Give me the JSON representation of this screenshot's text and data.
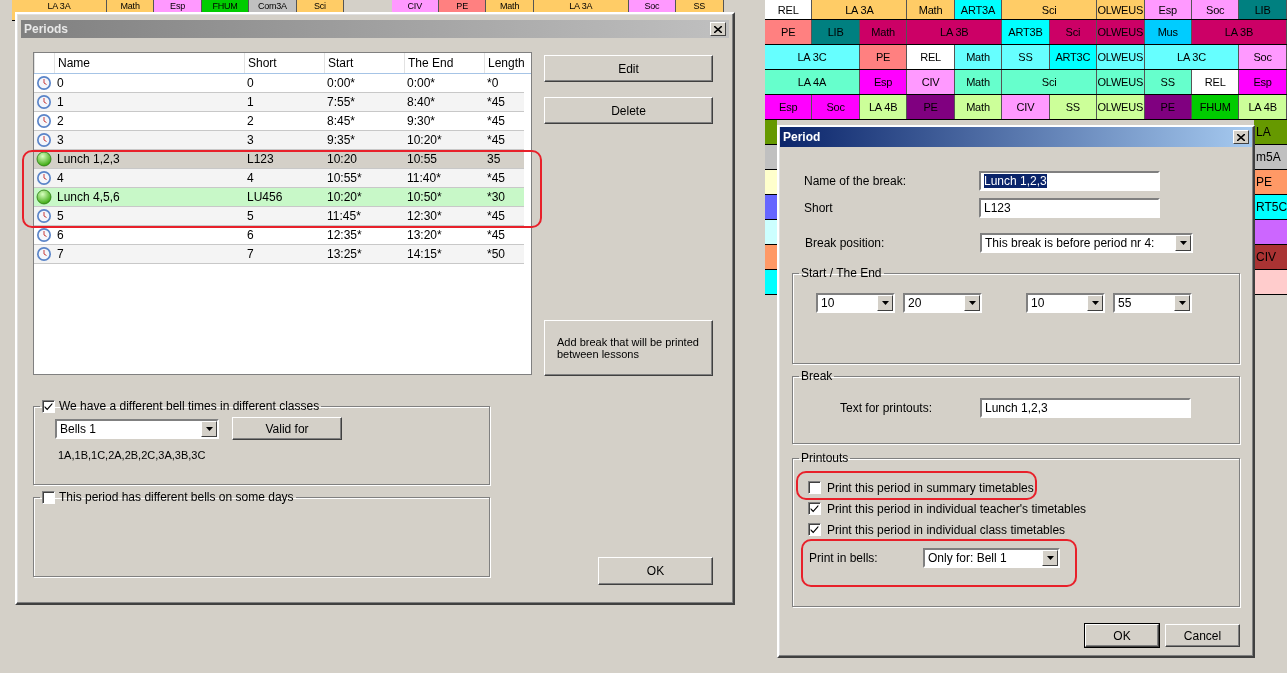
{
  "timetable": {
    "top_row": [
      {
        "kind": "double",
        "text": "LA 3A",
        "color": "#ffcc66"
      },
      {
        "kind": "covered"
      },
      {
        "kind": "single",
        "text": "Math",
        "color": "#ffcc66"
      },
      {
        "kind": "single",
        "text": "Esp",
        "color": "#ff99ff"
      },
      {
        "kind": "single",
        "text": "FHUM",
        "color": "#00cc00"
      },
      {
        "kind": "single",
        "text": "Com3A",
        "color": "#c0c0c0"
      },
      {
        "kind": "single",
        "text": "Sci",
        "color": "#ffcc66"
      },
      {
        "kind": "empty"
      },
      {
        "kind": "single",
        "text": "CIV",
        "color": "#ff99ff"
      },
      {
        "kind": "single",
        "text": "PE",
        "color": "#ff8080"
      },
      {
        "kind": "single",
        "text": "Math",
        "color": "#ffcc66"
      },
      {
        "kind": "double",
        "text": "LA 3A",
        "color": "#ffcc66"
      },
      {
        "kind": "covered"
      },
      {
        "kind": "single",
        "text": "Soc",
        "color": "#ff99ff"
      },
      {
        "kind": "single",
        "text": "SS",
        "color": "#ffcc66"
      }
    ],
    "rows": [
      [
        {
          "kind": "single",
          "text": "REL",
          "color": "#ffffff"
        },
        {
          "kind": "double",
          "text": "LA 3A",
          "color": "#ffcc66"
        },
        {
          "kind": "covered"
        },
        {
          "kind": "single",
          "text": "Math",
          "color": "#ffcc66"
        },
        {
          "kind": "single",
          "text": "ART3A",
          "color": "#00ffff"
        },
        {
          "kind": "double",
          "text": "Sci",
          "color": "#ffcc66"
        },
        {
          "kind": "covered"
        },
        {
          "kind": "single",
          "text": "OLWEUS",
          "color": "#ffcc66"
        },
        {
          "kind": "single",
          "text": "Esp",
          "color": "#ff99ff"
        },
        {
          "kind": "single",
          "text": "Soc",
          "color": "#ff99ff"
        },
        {
          "kind": "single",
          "text": "LIB",
          "color": "#008080"
        }
      ],
      [
        {
          "kind": "single",
          "text": "PE",
          "color": "#ff8080"
        },
        {
          "kind": "single",
          "text": "LIB",
          "color": "#008080"
        },
        {
          "kind": "single",
          "text": "Math",
          "color": "#cc0066"
        },
        {
          "kind": "double",
          "text": "LA 3B",
          "color": "#cc0066"
        },
        {
          "kind": "covered"
        },
        {
          "kind": "single",
          "text": "ART3B",
          "color": "#00ffff"
        },
        {
          "kind": "single",
          "text": "Sci",
          "color": "#cc0066"
        },
        {
          "kind": "single",
          "text": "OLWEUS",
          "color": "#cc0066"
        },
        {
          "kind": "single",
          "text": "Mus",
          "color": "#00ccff"
        },
        {
          "kind": "double",
          "text": "LA 3B",
          "color": "#cc0066"
        },
        {
          "kind": "covered"
        }
      ],
      [
        {
          "kind": "double",
          "text": "LA 3C",
          "color": "#66ffff"
        },
        {
          "kind": "covered"
        },
        {
          "kind": "single",
          "text": "PE",
          "color": "#ff8080"
        },
        {
          "kind": "single",
          "text": "REL",
          "color": "#ffffff"
        },
        {
          "kind": "single",
          "text": "Math",
          "color": "#66ffff"
        },
        {
          "kind": "single",
          "text": "SS",
          "color": "#66ffff"
        },
        {
          "kind": "single",
          "text": "ART3C",
          "color": "#00ffff"
        },
        {
          "kind": "single",
          "text": "OLWEUS",
          "color": "#66ffff"
        },
        {
          "kind": "double",
          "text": "LA 3C",
          "color": "#66ffff"
        },
        {
          "kind": "covered"
        },
        {
          "kind": "single",
          "text": "Soc",
          "color": "#ff99ff"
        }
      ],
      [
        {
          "kind": "double",
          "text": "LA 4A",
          "color": "#66ffcc"
        },
        {
          "kind": "covered"
        },
        {
          "kind": "single",
          "text": "Esp",
          "color": "#ff00ff"
        },
        {
          "kind": "single",
          "text": "CIV",
          "color": "#ff99ff"
        },
        {
          "kind": "single",
          "text": "Math",
          "color": "#66ffcc"
        },
        {
          "kind": "double",
          "text": "Sci",
          "color": "#66ffcc"
        },
        {
          "kind": "covered"
        },
        {
          "kind": "single",
          "text": "OLWEUS",
          "color": "#66ffcc"
        },
        {
          "kind": "single",
          "text": "SS",
          "color": "#66ffcc"
        },
        {
          "kind": "single",
          "text": "REL",
          "color": "#ffffff"
        },
        {
          "kind": "single",
          "text": "Esp",
          "color": "#ff00ff"
        }
      ],
      [
        {
          "kind": "single",
          "text": "Esp",
          "color": "#ff00ff"
        },
        {
          "kind": "single",
          "text": "Soc",
          "color": "#ff00ff"
        },
        {
          "kind": "single",
          "text": "LA 4B",
          "color": "#ccff99"
        },
        {
          "kind": "single",
          "text": "PE",
          "color": "#800080"
        },
        {
          "kind": "single",
          "text": "Math",
          "color": "#ccff99"
        },
        {
          "kind": "single",
          "text": "CIV",
          "color": "#ff99ff"
        },
        {
          "kind": "single",
          "text": "SS",
          "color": "#ccff99"
        },
        {
          "kind": "single",
          "text": "OLWEUS",
          "color": "#ccff99"
        },
        {
          "kind": "single",
          "text": "PE",
          "color": "#800080"
        },
        {
          "kind": "single",
          "text": "FHUM",
          "color": "#00cc00"
        },
        {
          "kind": "single",
          "text": "LA 4B",
          "color": "#ccff99"
        }
      ]
    ],
    "edge_rows": [
      {
        "left": {
          "color": "#669900"
        },
        "right": {
          "text": "LA",
          "color": "#669900"
        }
      },
      {
        "left": {
          "color": "#c0c0c0"
        },
        "right": {
          "text": "m5A",
          "color": "#c0c0c0"
        }
      },
      {
        "left": {
          "color": "#ffffcc"
        },
        "right": {
          "text": "PE",
          "color": "#ff9966"
        }
      },
      {
        "left": {
          "color": "#6666ff"
        },
        "right": {
          "text": "RT5C",
          "color": "#00ffff"
        }
      },
      {
        "left": {
          "color": "#ccffff"
        },
        "right": {
          "color": "#cc66ff"
        }
      },
      {
        "left": {
          "color": "#ff9966"
        },
        "right": {
          "text": "CIV",
          "color": "#aa3333"
        }
      },
      {
        "left": {
          "color": "#00ffff"
        },
        "right": {
          "color": "#ffcccc"
        }
      }
    ]
  },
  "periods_window": {
    "title": "Periods",
    "columns": [
      "Name",
      "Short",
      "Start",
      "The End",
      "Length"
    ],
    "rows": [
      {
        "kind": "period",
        "name": "0",
        "short": "0",
        "start": "0:00*",
        "end": "0:00*",
        "length": "*0",
        "selected": false
      },
      {
        "kind": "period",
        "name": "1",
        "short": "1",
        "start": "7:55*",
        "end": "8:40*",
        "length": "*45",
        "selected": false
      },
      {
        "kind": "period",
        "name": "2",
        "short": "2",
        "start": "8:45*",
        "end": "9:30*",
        "length": "*45",
        "selected": false
      },
      {
        "kind": "period",
        "name": "3",
        "short": "3",
        "start": "9:35*",
        "end": "10:20*",
        "length": "*45",
        "selected": false
      },
      {
        "kind": "break",
        "name": "Lunch 1,2,3",
        "short": "L123",
        "start": "10:20",
        "end": "10:55",
        "length": "35",
        "selected": true
      },
      {
        "kind": "period",
        "name": "4",
        "short": "4",
        "start": "10:55*",
        "end": "11:40*",
        "length": "*45",
        "selected": false
      },
      {
        "kind": "break",
        "name": "Lunch 4,5,6",
        "short": "LU456",
        "start": "10:20*",
        "end": "10:50*",
        "length": "*30",
        "selected": false
      },
      {
        "kind": "period",
        "name": "5",
        "short": "5",
        "start": "11:45*",
        "end": "12:30*",
        "length": "*45",
        "selected": false
      },
      {
        "kind": "period",
        "name": "6",
        "short": "6",
        "start": "12:35*",
        "end": "13:20*",
        "length": "*45",
        "selected": false
      },
      {
        "kind": "period",
        "name": "7",
        "short": "7",
        "start": "13:25*",
        "end": "14:15*",
        "length": "*50",
        "selected": false
      }
    ],
    "edit_button": "Edit",
    "delete_button": "Delete",
    "add_break_button": "Add break that will be printed between lessons",
    "classes_group": {
      "label": "We have a different bell times in different classes",
      "checked": true,
      "bells": "Bells 1",
      "valid_for_button": "Valid for",
      "classes": "1A,1B,1C,2A,2B,2C,3A,3B,3C"
    },
    "days_group": {
      "label": "This period has different bells on some days",
      "checked": false
    },
    "ok_button": "OK"
  },
  "period_dialog": {
    "title": "Period",
    "name_label": "Name of the break:",
    "name": "Lunch 1,2,3",
    "name_highlighted": true,
    "short_label": "Short",
    "short": "L123",
    "position_label": "Break position:",
    "position": "This break is before period nr 4:",
    "times_group": "Start / The End",
    "times": [
      "10",
      "20",
      "10",
      "55"
    ],
    "break_group": "Break",
    "printout_text_label": "Text for printouts:",
    "printout_text": "Lunch 1,2,3",
    "printouts_group": "Printouts",
    "options": [
      {
        "label": "Print this period in summary timetables",
        "checked": false
      },
      {
        "label": "Print this period in individual teacher's timetables",
        "checked": true
      },
      {
        "label": "Print this period in individual class timetables",
        "checked": true
      }
    ],
    "bells_label": "Print in bells:",
    "bells": "Only for: Bell 1",
    "ok_button": "OK",
    "cancel_button": "Cancel"
  }
}
